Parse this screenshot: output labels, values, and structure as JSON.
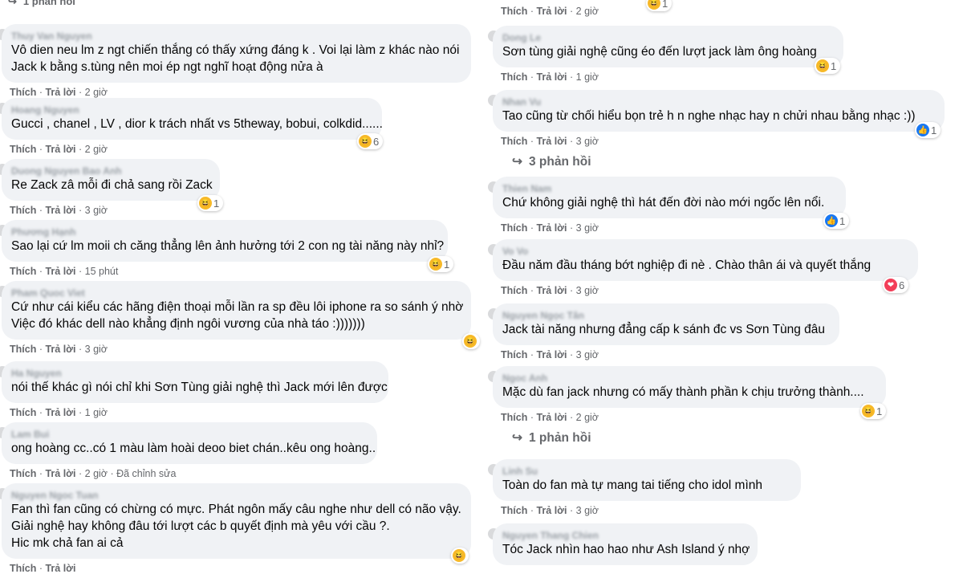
{
  "left": [
    {
      "author": "Thuy Van Nguyen",
      "lines": [
        "Vô dien neu lm z ngt chiến thắng có thấy xứng đáng k . Voi lại làm z khác nào nói",
        "Jack k bằng s.tùng nên moi ép ngt nghĩ hoạt động nửa à"
      ],
      "like": "Thích",
      "reply": "Trả lời",
      "time": "2 giờ",
      "reaction": null
    },
    {
      "author": "Hoang Nguyen",
      "lines": [
        "Gucci , chanel , LV , dior k trách nhất vs 5theway, bobui, colkdid......"
      ],
      "like": "Thích",
      "reply": "Trả lời",
      "time": "2 giờ",
      "reaction": {
        "type": "haha",
        "count": "6"
      }
    },
    {
      "author": "Duong Nguyen Bao Anh",
      "lines": [
        "Re Zack zâ mỗi đi chả sang rồi Zack"
      ],
      "like": "Thích",
      "reply": "Trả lời",
      "time": "3 giờ",
      "reaction": {
        "type": "haha",
        "count": "1"
      }
    },
    {
      "author": "Phương Hạnh",
      "lines": [
        "Sao lại cứ lm moii ch căng thẳng lên ảnh hưởng tới 2 con ng tài năng này nhỉ?"
      ],
      "like": "Thích",
      "reply": "Trả lời",
      "time": "15 phút",
      "reaction": {
        "type": "haha",
        "count": "1"
      }
    },
    {
      "author": "Pham Quoc Viet",
      "lines": [
        "Cứ như cái kiểu các hãng điện thoại mỗi lần ra sp đều lôi iphone ra so sánh ý nhờ",
        "Việc đó khác dell nào khẳng định ngôi vương của nhà táo :)))))))"
      ],
      "like": "Thích",
      "reply": "Trả lời",
      "time": "3 giờ",
      "reaction": {
        "type": "haha",
        "count": ""
      }
    },
    {
      "author": "Ha Nguyen",
      "lines": [
        "nói thế khác gì nói chỉ khi Sơn Tùng giải nghệ thì Jack mới lên được"
      ],
      "like": "Thích",
      "reply": "Trả lời",
      "time": "1 giờ",
      "reaction": null
    },
    {
      "author": "Lam Bui",
      "lines": [
        "ong hoàng cc..có 1 màu làm hoài deoo biet chán..kêu ong hoàng.."
      ],
      "like": "Thích",
      "reply": "Trả lời",
      "time": "2 giờ",
      "edited": "Đã chỉnh sửa",
      "reaction": null
    },
    {
      "author": "Nguyen Ngoc Tuan",
      "lines": [
        "Fan thì fan cũng có chừng có mực. Phát ngôn mấy câu nghe như dell có não vậy.",
        "Giải nghệ hay không đâu tới lượt các b quyết định mà yêu với cầu ?.",
        "Hic mk chả fan ai cả"
      ],
      "like": "Thích",
      "reply": "Trả lời",
      "time": "",
      "reaction": {
        "type": "haha",
        "count": ""
      }
    }
  ],
  "left_top_replies": "1 phản hồi",
  "right": [
    {
      "author": "",
      "lines": [],
      "like": "Thích",
      "reply": "Trả lời",
      "time": "2 giờ",
      "reaction": {
        "type": "haha",
        "count": "1"
      }
    },
    {
      "author": "Dong Le",
      "lines": [
        "Sơn tùng giải nghệ cũng éo đến lượt jack làm ông hoàng"
      ],
      "like": "Thích",
      "reply": "Trả lời",
      "time": "1 giờ",
      "reaction": {
        "type": "haha",
        "count": "1"
      }
    },
    {
      "author": "Nhan Vu",
      "lines": [
        "Tao cũng từ chối hiểu bọn trẻ h n nghe nhạc hay n chửi nhau bằng nhạc :))"
      ],
      "like": "Thích",
      "reply": "Trả lời",
      "time": "3 giờ",
      "reaction": {
        "type": "like",
        "count": "1"
      },
      "replies": "3 phản hồi"
    },
    {
      "author": "Thien Nam",
      "lines": [
        "Chứ không giải nghệ thì hát đến đời nào mới ngốc lên nổi."
      ],
      "like": "Thích",
      "reply": "Trả lời",
      "time": "3 giờ",
      "reaction": {
        "type": "like",
        "count": "1"
      }
    },
    {
      "author": "Vo Vo",
      "lines": [
        "Đầu năm đầu tháng bớt nghiệp đi nè . Chào thân ái và quyết thắng"
      ],
      "like": "Thích",
      "reply": "Trả lời",
      "time": "3 giờ",
      "reaction": {
        "type": "love",
        "count": "6"
      }
    },
    {
      "author": "Nguyen Ngọc Tân",
      "lines": [
        "Jack tài năng nhưng đẳng cấp k sánh đc vs Sơn Tùng đâu"
      ],
      "like": "Thích",
      "reply": "Trả lời",
      "time": "3 giờ",
      "reaction": null
    },
    {
      "author": "Ngoc Anh",
      "lines": [
        "Mặc dù fan jack nhưng có mấy thành phần k chịu trưởng thành...."
      ],
      "like": "Thích",
      "reply": "Trả lời",
      "time": "2 giờ",
      "reaction": {
        "type": "haha",
        "count": "1"
      },
      "replies": "1 phản hồi"
    },
    {
      "author": "Linh Su",
      "lines": [
        "Toàn do fan mà tự mang tai tiếng cho idol mình"
      ],
      "like": "Thích",
      "reply": "Trả lời",
      "time": "3 giờ",
      "reaction": null
    },
    {
      "author": "Nguyen Thang Chien",
      "lines": [
        "Tóc Jack nhìn hao hao như Ash Island ý nhợ"
      ],
      "like": "",
      "reply": "",
      "time": "",
      "reaction": null
    }
  ],
  "colors": {
    "bubble": "#f0f2f5",
    "meta": "#65676b",
    "text": "#050505",
    "haha": "#f7b928",
    "like": "#1877f2",
    "love": "#f33e58"
  }
}
